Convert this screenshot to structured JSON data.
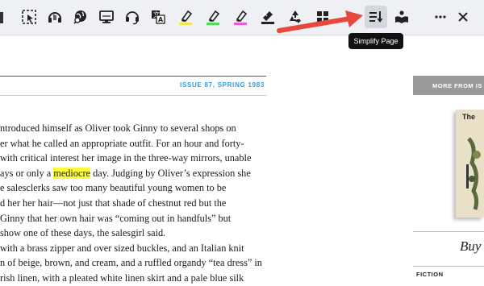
{
  "toolbar": {
    "tooltip": "Simplify Page",
    "tools": [
      "select-cursor-icon",
      "headphones-icon",
      "globe-search-icon",
      "monitor-icon",
      "headset-icon",
      "translate-icon",
      "highlighter-yellow-icon",
      "highlighter-green-icon",
      "highlighter-pink-icon",
      "eraser-icon",
      "recycle-icon",
      "grid-icon",
      "simplify-page-icon",
      "reading-icon",
      "more-icon",
      "close-icon"
    ],
    "colors": {
      "yellow": "#f4e64a",
      "green": "#4ee04e",
      "pink": "#f05ad8",
      "accent": "#2d9de0",
      "arrow": "#e8473c"
    }
  },
  "article": {
    "issue": "ISSUE 87, SPRING 1983",
    "lines": [
      {
        "pre": "ntroduced himself as Oliver took Ginny to several shops on"
      },
      {
        "pre": "er what he called an appropriate outfit. For an hour and forty-"
      },
      {
        "pre": "with critical interest her image in the three-way mirrors, unable"
      },
      {
        "pre": "ays or only a ",
        "hl": "mediocre",
        "post": " day. Judging by Oliver’s expression she"
      },
      {
        "pre": "e salesclerks saw too many beautiful young women to be"
      },
      {
        "pre": "d her her hair—not just that shade of chestnut red but the"
      },
      {
        "pre": "Ginny that her own hair was “coming out in handfuls” but"
      },
      {
        "pre": "show one of these days, the salesgirl said."
      },
      {
        "pre": "with a brass zipper and over sized buckles, and an Italian knit"
      },
      {
        "pre": "n of beige, brown, and cream, and a ruffled organdy “tea dress” in"
      },
      {
        "pre": "rish linen, with a pleated white linen skirt and a pale blue silk"
      }
    ]
  },
  "sidebar": {
    "heading": "MORE FROM IS",
    "book_title": "The",
    "buy": "Buy",
    "category": "FICTION"
  }
}
